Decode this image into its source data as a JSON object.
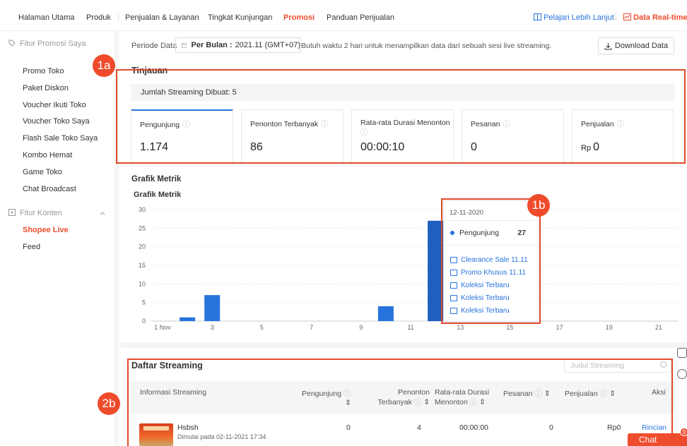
{
  "topnav": {
    "items": [
      "Halaman Utama",
      "Produk",
      "Penjualan & Layanan",
      "Tingkat Kunjungan",
      "Promosi",
      "Panduan Penjualan"
    ],
    "active": "Promosi",
    "learn_more": "Pelajari Lebih Lanjut",
    "realtime": "Data Real-time"
  },
  "sidebar": {
    "group1": "Fitur Promosi Saya",
    "group1_items": [
      "Promo Toko",
      "Paket Diskon",
      "Voucher Ikuti Toko",
      "Voucher Toko Saya",
      "Flash Sale Toko Saya",
      "Kombo Hemat",
      "Game Toko",
      "Chat Broadcast"
    ],
    "group2": "Fitur Konten",
    "group2_items": [
      "Shopee Live",
      "Feed"
    ],
    "active_item": "Shopee Live"
  },
  "periode": {
    "label": "Periode Data",
    "mode": "Per Bulan :",
    "value": "2021.11 (GMT+07)",
    "note": "Butuh waktu 2 hari untuk menampilkan data dari sebuah sesi live streaming.",
    "download": "Download Data"
  },
  "overview": {
    "title": "Tinjauan",
    "count_label": "Jumlah Streaming Dibuat: 5",
    "metrics": [
      {
        "label": "Pengunjung",
        "value": "1.174"
      },
      {
        "label": "Penonton Terbanyak",
        "value": "86"
      },
      {
        "label": "Rata-rata Durasi Menonton",
        "value": "00:00:10"
      },
      {
        "label": "Pesanan",
        "value": "0"
      },
      {
        "label": "Penjualan",
        "currency": "Rp",
        "value": "0"
      }
    ]
  },
  "annotations": {
    "a": "1a",
    "b": "1b",
    "c": "2b"
  },
  "chart_section": {
    "title": "Grafik Metrik",
    "subtitle": "Grafik Metrik"
  },
  "chart_data": {
    "type": "bar",
    "x_tick_labels": [
      "1 Nov",
      "3",
      "5",
      "7",
      "9",
      "11",
      "13",
      "15",
      "17",
      "19",
      "21"
    ],
    "x_tick_days": [
      1,
      3,
      5,
      7,
      9,
      11,
      13,
      15,
      17,
      19,
      21
    ],
    "series": [
      {
        "name": "Pengunjung",
        "color": "#2673dd",
        "x": [
          2,
          3,
          10,
          12
        ],
        "values": [
          1,
          7,
          4,
          27
        ]
      }
    ],
    "ylim": [
      0,
      30
    ],
    "yticks": [
      0,
      5,
      10,
      15,
      20,
      25,
      30
    ],
    "grid": true
  },
  "tooltip": {
    "date": "12-11-2020",
    "series_name": "Pengunjung",
    "series_value": "27",
    "links": [
      "Clearance Sale 11.11",
      "Promo Khusus 11.11",
      "Koleksi Terbaru",
      "Koleksi Terbaru",
      "Koleksi Terbaru"
    ]
  },
  "streaming": {
    "title": "Daftar Streaming",
    "search_placeholder": "Judul Streaming",
    "columns": {
      "info": "Informasi Streaming",
      "visitors": "Pengunjung",
      "peak_line1": "Penonton",
      "peak_line2": "Terbanyak",
      "avg_line1": "Rata-rata Durasi",
      "avg_line2": "Menonton",
      "orders": "Pesanan",
      "sales": "Penjualan",
      "action": "Aksi"
    },
    "rows": [
      {
        "name": "Hsbsh",
        "started": "Dimulai pada 02-11-2021 17:34",
        "visitors": "0",
        "peak": "4",
        "avg": "00:00:00",
        "orders": "0",
        "sales": "Rp0",
        "action": "Rincian"
      }
    ]
  },
  "chat": {
    "label": "Chat",
    "badge": "9"
  }
}
